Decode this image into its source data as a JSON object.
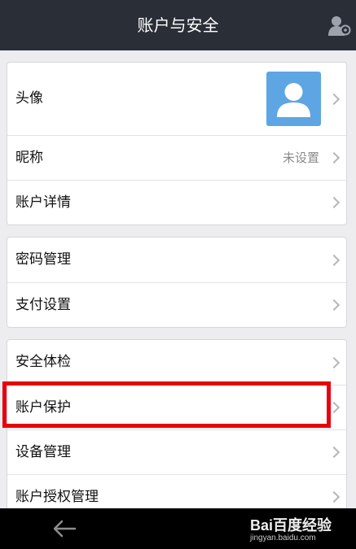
{
  "header": {
    "title": "账户与安全",
    "right_icon": "user-settings-icon"
  },
  "groups": [
    {
      "items": [
        {
          "label": "头像",
          "value": ""
        },
        {
          "label": "昵称",
          "value": "未设置"
        },
        {
          "label": "账户详情",
          "value": ""
        }
      ]
    },
    {
      "items": [
        {
          "label": "密码管理",
          "value": ""
        },
        {
          "label": "支付设置",
          "value": ""
        }
      ]
    },
    {
      "items": [
        {
          "label": "安全体检",
          "value": ""
        },
        {
          "label": "账户保护",
          "value": ""
        },
        {
          "label": "设备管理",
          "value": ""
        },
        {
          "label": "账户授权管理",
          "value": ""
        }
      ]
    }
  ],
  "nav": {
    "back_icon": "back-arrow-icon"
  },
  "watermark": {
    "brand": "Bai百度经验",
    "site": "jingyan.baidu.com"
  },
  "colors": {
    "titlebar": "#2a2e37",
    "avatar": "#5ea5e4",
    "highlight": "#e8000d",
    "background": "#ededf0"
  }
}
